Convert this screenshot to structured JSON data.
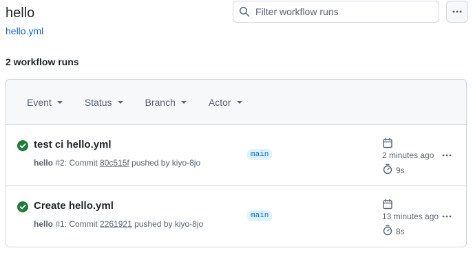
{
  "header": {
    "title": "hello",
    "file_link": "hello.yml"
  },
  "search": {
    "placeholder": "Filter workflow runs",
    "value": ""
  },
  "summary": {
    "runs_count": "2 workflow runs"
  },
  "filters": [
    {
      "label": "Event"
    },
    {
      "label": "Status"
    },
    {
      "label": "Branch"
    },
    {
      "label": "Actor"
    }
  ],
  "runs": [
    {
      "status": "success",
      "title": "test ci hello.yml",
      "workflow": "hello",
      "meta_prefix": " #2: Commit ",
      "commit": "80c515f",
      "meta_suffix": " pushed by kiyo-8jo",
      "branch": "main",
      "time_ago": "2 minutes ago",
      "duration": "9s"
    },
    {
      "status": "success",
      "title": "Create hello.yml",
      "workflow": "hello",
      "meta_prefix": " #1: Commit ",
      "commit": "2261921",
      "meta_suffix": " pushed by kiyo-8jo",
      "branch": "main",
      "time_ago": "13 minutes ago",
      "duration": "8s"
    }
  ],
  "colors": {
    "success": "#1a7f37",
    "link": "#0969da",
    "muted": "#59636e",
    "border": "#d0d7de"
  },
  "icons": {
    "search": "search-icon",
    "more": "kebab-horizontal-icon",
    "status": "check-circle-fill-icon",
    "calendar": "calendar-icon",
    "timer": "stopwatch-icon"
  }
}
